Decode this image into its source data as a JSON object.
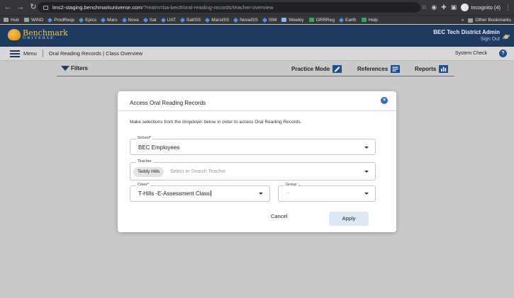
{
  "browser": {
    "url_host": "lms2-staging.benchmarkuniverse.com",
    "url_rest": "/?realm=ba-bec#/oral-reading-records/teacher-overview",
    "profile_label": "Incognito (4)",
    "bookmarks": [
      "Hub",
      "WIND",
      "ProdReqs",
      "Epics",
      "Mars",
      "Nova",
      "Sat",
      "UAT",
      "SatISS",
      "MarsISS",
      "NovaISS",
      "SIM",
      "Weekly",
      "ORRReg",
      "Earth",
      "Help"
    ],
    "more_label": "»",
    "other_bookmarks": "Other Bookmarks"
  },
  "header": {
    "logo_line1": "Benchmark",
    "logo_line2": "UNIVERSE",
    "user_name": "BEC Tech District Admin",
    "sign_out": "Sign Out"
  },
  "subnav": {
    "menu_label": "Menu",
    "breadcrumb": "Oral Reading Records | Class Overview",
    "system_check": "System Check",
    "help_label": "?"
  },
  "toolbar": {
    "filters_label": "Filters",
    "practice_mode": "Practice Mode",
    "references": "References",
    "reports": "Reports"
  },
  "modal": {
    "title": "Access Oral Reading Records",
    "description": "Make selections from the dropdown below in order to access Oral Reading Records.",
    "school_label": "School*",
    "school_value": "BEC Employees",
    "teacher_label": "Teacher",
    "teacher_chip": "Teddy Hills",
    "teacher_placeholder": "Select or Search Teacher",
    "class_label": "Class*",
    "class_value": "T-Hills -E-Assessment Class",
    "group_label": "Group",
    "group_value": "--",
    "cancel_label": "Cancel",
    "apply_label": "Apply",
    "close_glyph": "×"
  },
  "colors": {
    "header_bg": "#1f3a5f",
    "accent_blue": "#2f6cc0",
    "apply_bg": "#dce9f5"
  }
}
